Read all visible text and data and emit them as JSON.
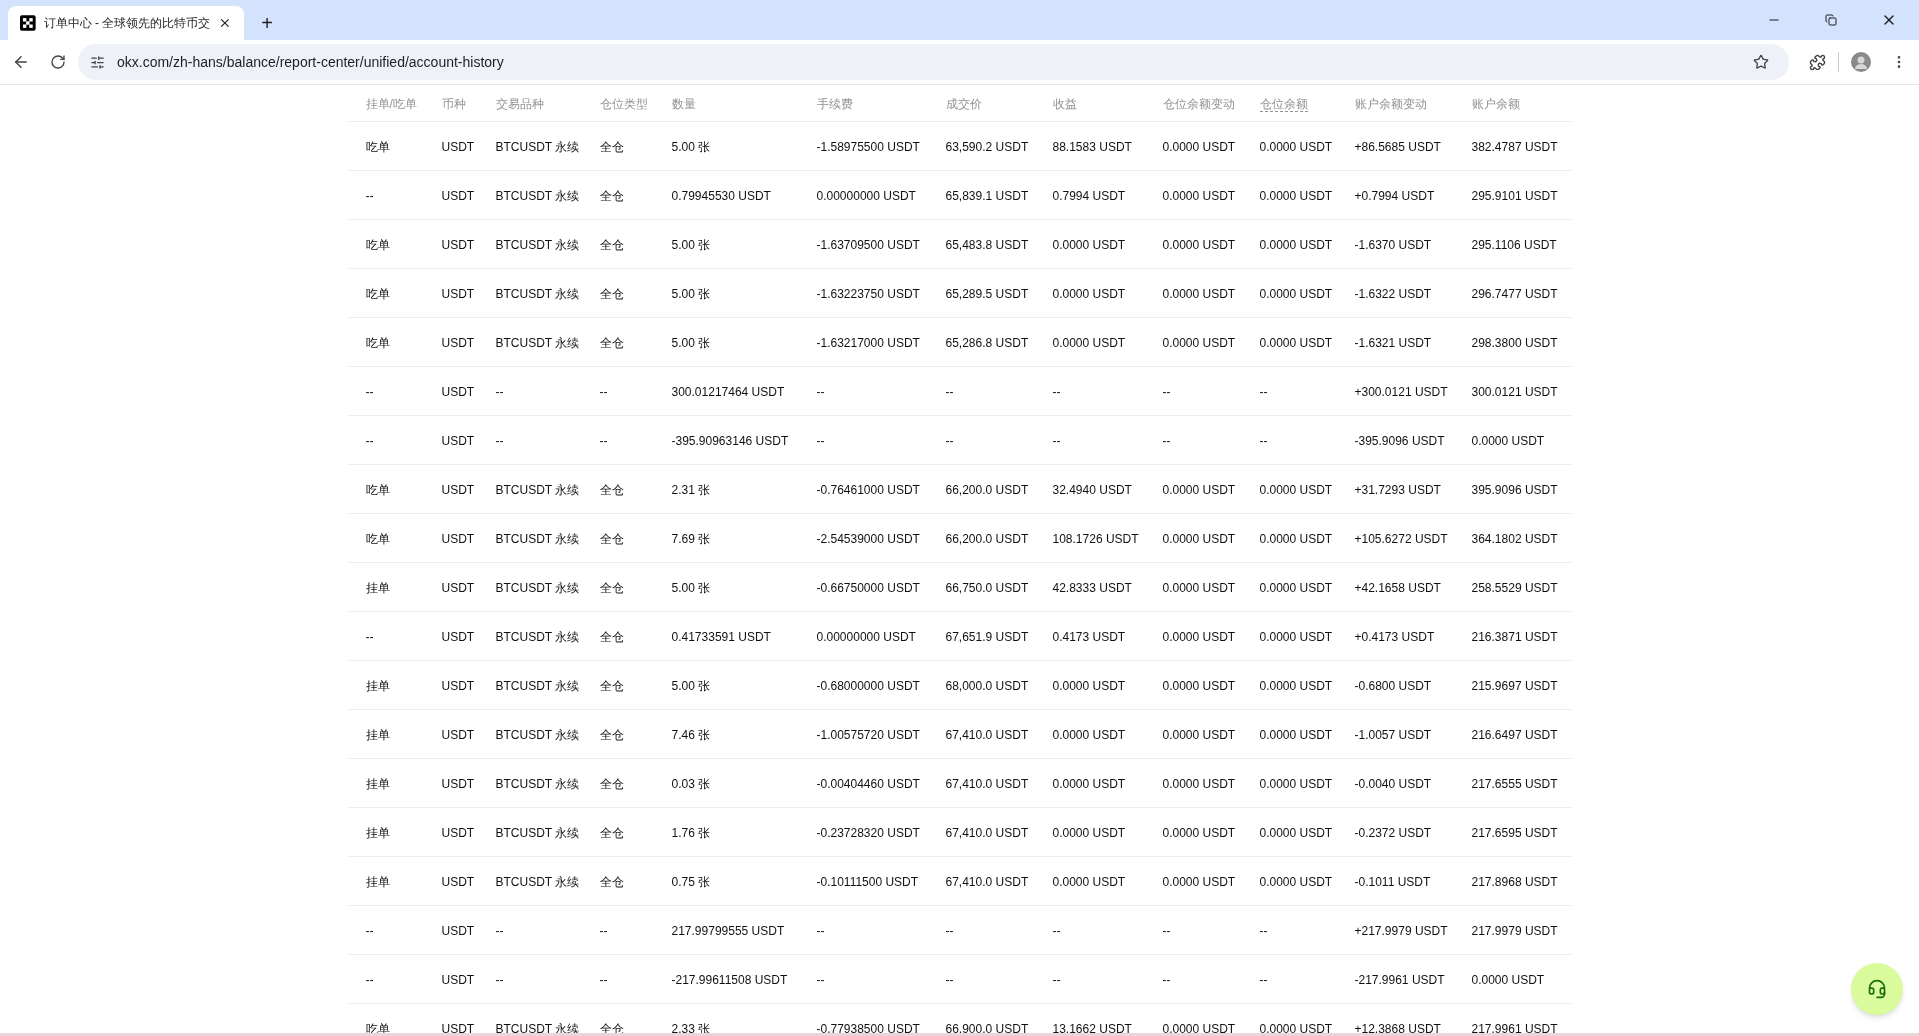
{
  "browser": {
    "tab": {
      "title": "订单中心 - 全球领先的比特币交",
      "selected": true
    },
    "new_tab": "+",
    "url": "okx.com/zh-hans/balance/report-center/unified/account-history"
  },
  "table": {
    "columns": [
      {
        "label": "挂单/吃单",
        "underlined": false
      },
      {
        "label": "币种",
        "underlined": false
      },
      {
        "label": "交易品种",
        "underlined": false
      },
      {
        "label": "仓位类型",
        "underlined": false
      },
      {
        "label": "数量",
        "underlined": false
      },
      {
        "label": "手续费",
        "underlined": false
      },
      {
        "label": "成交价",
        "underlined": false
      },
      {
        "label": "收益",
        "underlined": false
      },
      {
        "label": "仓位余额变动",
        "underlined": false
      },
      {
        "label": "仓位余额",
        "underlined": true
      },
      {
        "label": "账户余额变动",
        "underlined": false
      },
      {
        "label": "账户余额",
        "underlined": false
      }
    ],
    "rows": [
      [
        "吃单",
        "USDT",
        "BTCUSDT 永续",
        "全仓",
        "5.00 张",
        "-1.58975500 USDT",
        "63,590.2 USDT",
        "88.1583 USDT",
        "0.0000 USDT",
        "0.0000 USDT",
        "+86.5685 USDT",
        "382.4787 USDT"
      ],
      [
        "--",
        "USDT",
        "BTCUSDT 永续",
        "全仓",
        "0.79945530 USDT",
        "0.00000000 USDT",
        "65,839.1 USDT",
        "0.7994 USDT",
        "0.0000 USDT",
        "0.0000 USDT",
        "+0.7994 USDT",
        "295.9101 USDT"
      ],
      [
        "吃单",
        "USDT",
        "BTCUSDT 永续",
        "全仓",
        "5.00 张",
        "-1.63709500 USDT",
        "65,483.8 USDT",
        "0.0000 USDT",
        "0.0000 USDT",
        "0.0000 USDT",
        "-1.6370 USDT",
        "295.1106 USDT"
      ],
      [
        "吃单",
        "USDT",
        "BTCUSDT 永续",
        "全仓",
        "5.00 张",
        "-1.63223750 USDT",
        "65,289.5 USDT",
        "0.0000 USDT",
        "0.0000 USDT",
        "0.0000 USDT",
        "-1.6322 USDT",
        "296.7477 USDT"
      ],
      [
        "吃单",
        "USDT",
        "BTCUSDT 永续",
        "全仓",
        "5.00 张",
        "-1.63217000 USDT",
        "65,286.8 USDT",
        "0.0000 USDT",
        "0.0000 USDT",
        "0.0000 USDT",
        "-1.6321 USDT",
        "298.3800 USDT"
      ],
      [
        "--",
        "USDT",
        "--",
        "--",
        "300.01217464 USDT",
        "--",
        "--",
        "--",
        "--",
        "--",
        "+300.0121 USDT",
        "300.0121 USDT"
      ],
      [
        "--",
        "USDT",
        "--",
        "--",
        "-395.90963146 USDT",
        "--",
        "--",
        "--",
        "--",
        "--",
        "-395.9096 USDT",
        "0.0000 USDT"
      ],
      [
        "吃单",
        "USDT",
        "BTCUSDT 永续",
        "全仓",
        "2.31 张",
        "-0.76461000 USDT",
        "66,200.0 USDT",
        "32.4940 USDT",
        "0.0000 USDT",
        "0.0000 USDT",
        "+31.7293 USDT",
        "395.9096 USDT"
      ],
      [
        "吃单",
        "USDT",
        "BTCUSDT 永续",
        "全仓",
        "7.69 张",
        "-2.54539000 USDT",
        "66,200.0 USDT",
        "108.1726 USDT",
        "0.0000 USDT",
        "0.0000 USDT",
        "+105.6272 USDT",
        "364.1802 USDT"
      ],
      [
        "挂单",
        "USDT",
        "BTCUSDT 永续",
        "全仓",
        "5.00 张",
        "-0.66750000 USDT",
        "66,750.0 USDT",
        "42.8333 USDT",
        "0.0000 USDT",
        "0.0000 USDT",
        "+42.1658 USDT",
        "258.5529 USDT"
      ],
      [
        "--",
        "USDT",
        "BTCUSDT 永续",
        "全仓",
        "0.41733591 USDT",
        "0.00000000 USDT",
        "67,651.9 USDT",
        "0.4173 USDT",
        "0.0000 USDT",
        "0.0000 USDT",
        "+0.4173 USDT",
        "216.3871 USDT"
      ],
      [
        "挂单",
        "USDT",
        "BTCUSDT 永续",
        "全仓",
        "5.00 张",
        "-0.68000000 USDT",
        "68,000.0 USDT",
        "0.0000 USDT",
        "0.0000 USDT",
        "0.0000 USDT",
        "-0.6800 USDT",
        "215.9697 USDT"
      ],
      [
        "挂单",
        "USDT",
        "BTCUSDT 永续",
        "全仓",
        "7.46 张",
        "-1.00575720 USDT",
        "67,410.0 USDT",
        "0.0000 USDT",
        "0.0000 USDT",
        "0.0000 USDT",
        "-1.0057 USDT",
        "216.6497 USDT"
      ],
      [
        "挂单",
        "USDT",
        "BTCUSDT 永续",
        "全仓",
        "0.03 张",
        "-0.00404460 USDT",
        "67,410.0 USDT",
        "0.0000 USDT",
        "0.0000 USDT",
        "0.0000 USDT",
        "-0.0040 USDT",
        "217.6555 USDT"
      ],
      [
        "挂单",
        "USDT",
        "BTCUSDT 永续",
        "全仓",
        "1.76 张",
        "-0.23728320 USDT",
        "67,410.0 USDT",
        "0.0000 USDT",
        "0.0000 USDT",
        "0.0000 USDT",
        "-0.2372 USDT",
        "217.6595 USDT"
      ],
      [
        "挂单",
        "USDT",
        "BTCUSDT 永续",
        "全仓",
        "0.75 张",
        "-0.10111500 USDT",
        "67,410.0 USDT",
        "0.0000 USDT",
        "0.0000 USDT",
        "0.0000 USDT",
        "-0.1011 USDT",
        "217.8968 USDT"
      ],
      [
        "--",
        "USDT",
        "--",
        "--",
        "217.99799555 USDT",
        "--",
        "--",
        "--",
        "--",
        "--",
        "+217.9979 USDT",
        "217.9979 USDT"
      ],
      [
        "--",
        "USDT",
        "--",
        "--",
        "-217.99611508 USDT",
        "--",
        "--",
        "--",
        "--",
        "--",
        "-217.9961 USDT",
        "0.0000 USDT"
      ],
      [
        "吃单",
        "USDT",
        "BTCUSDT 永续",
        "全仓",
        "2.33 张",
        "-0.77938500 USDT",
        "66,900.0 USDT",
        "13.1662 USDT",
        "0.0000 USDT",
        "0.0000 USDT",
        "+12.3868 USDT",
        "217.9961 USDT"
      ]
    ]
  }
}
